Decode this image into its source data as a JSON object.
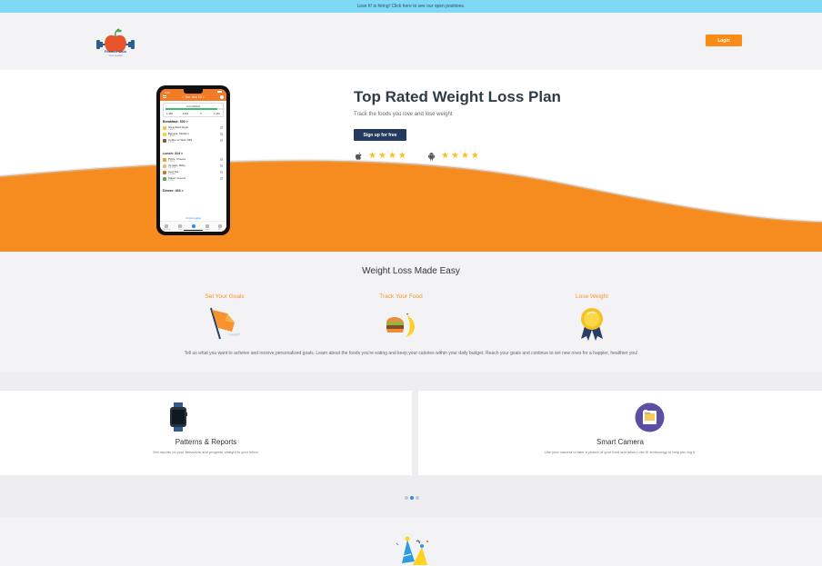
{
  "topbar": {
    "text": "Lose It! is hiring! Click here to see our open positions."
  },
  "header": {
    "logo_text": "Fitness Club",
    "logo_subtext": "Your Health",
    "login_label": "Login",
    "accent_color": "#f98b16"
  },
  "hero": {
    "title": "Top Rated Weight Loss Plan",
    "subtitle": "Track the foods you love and lose weight",
    "signup_label": "Sign up for free",
    "apple_rating_stars": 4,
    "android_rating_stars": 4,
    "phone": {
      "time": "9:41",
      "date_label": "< Tue, Nov 10 >",
      "calories_label": "CALORIES",
      "calorie_progress_fraction": 0.87,
      "calorie_numbers": [
        "1,450",
        "1,261",
        "0",
        "1,261"
      ],
      "meals": [
        {
          "label": "Breakfast: 300 >",
          "foods": [
            {
              "name": "Scrambled Eggs",
              "detail": "2 Each",
              "color": "#f5c431"
            },
            {
              "name": "Banana, Medium",
              "detail": "1 Each",
              "color": "#f3d44b"
            },
            {
              "name": "Coffee w/ Skim Milk",
              "detail": "1 Cup",
              "color": "#8b5a2b"
            }
          ]
        },
        {
          "label": "Lunch: 314 >",
          "foods": [
            {
              "name": "Pizza, Cheese",
              "detail": "1 Slice",
              "color": "#e8a23a"
            },
            {
              "name": "Cereals, Baby",
              "detail": "1/2 Cup",
              "color": "#e5c07a"
            },
            {
              "name": "Iced Tea",
              "detail": "1 Glass",
              "color": "#c77b31"
            },
            {
              "name": "Salad, Greens",
              "detail": "1 Cup",
              "color": "#5aae4a"
            }
          ]
        },
        {
          "label": "Dinner: 463 >",
          "foods": []
        }
      ],
      "control_label": "Control Logging",
      "tab_labels": [
        "My Day",
        "Log",
        "",
        "Goals",
        "Me"
      ]
    }
  },
  "easy": {
    "title": "Weight Loss Made Easy",
    "columns": [
      {
        "title": "Set Your Goals",
        "icon": "flag-icon"
      },
      {
        "title": "Track Your Food",
        "icon": "burger-banana-icon"
      },
      {
        "title": "Lose Weight",
        "icon": "medal-icon"
      }
    ],
    "description": "Tell us what you want to acheive and receive personalized goals.  Learn about the foods you're eating and keep your calories within your daily budget.  Reach your goals and continue to set new ones for a happier, healthier you!"
  },
  "features": {
    "cards": [
      {
        "title": "Patterns & Reports",
        "desc": "Get reports on your behaviors and progress straight to your inbox.",
        "icon": "smartwatch-icon"
      },
      {
        "title": "Smart Camera",
        "desc": "Use your camera to take a picture of your food and allow Lose It! technology to help you log it.",
        "icon": "camera-food-icon"
      }
    ],
    "carousel_pages": 3,
    "carousel_active": 2
  },
  "bottom": {
    "icon": "party-hats-icon"
  }
}
